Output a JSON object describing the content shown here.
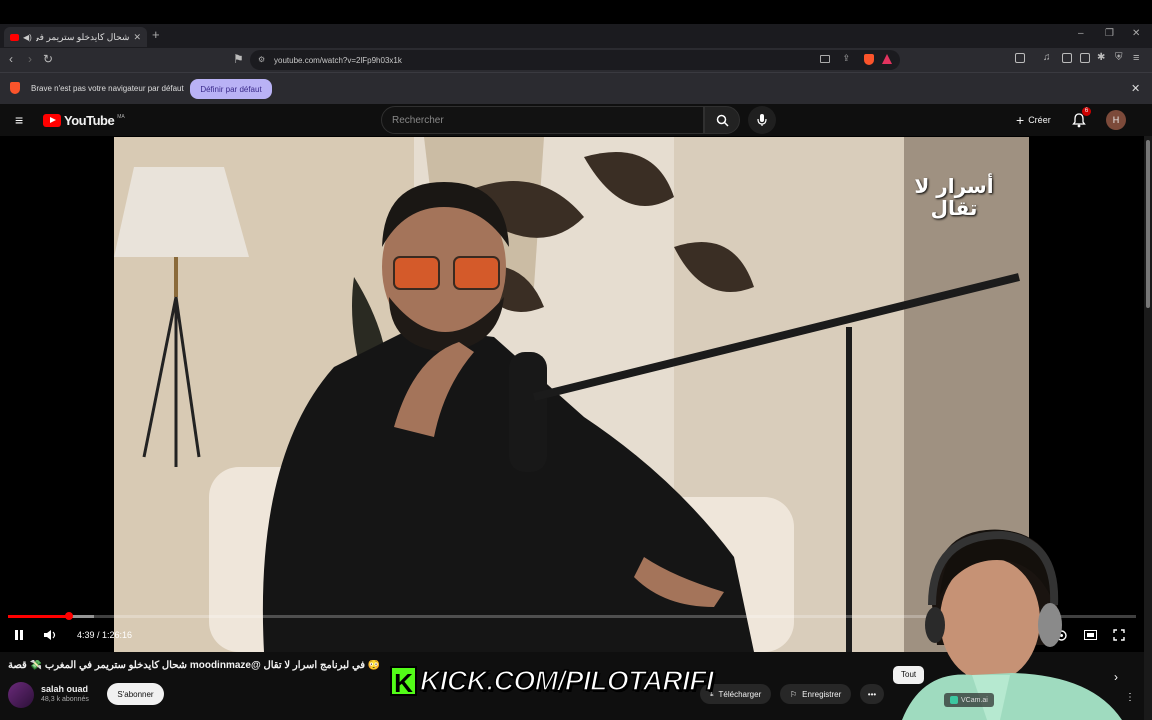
{
  "browser": {
    "tab_title": "شحال كايدخلو ستريمر في",
    "new_tab": "+",
    "url": "youtube.com/watch?v=2lFp9h03x1k",
    "infobar_text": "Brave n'est pas votre navigateur par défaut",
    "infobar_button": "Définir par défaut",
    "win_min": "–",
    "win_max": "❐",
    "win_close": "✕"
  },
  "youtube": {
    "logo_text": "YouTube",
    "country_code": "MA",
    "search_placeholder": "Rechercher",
    "create_label": "Créer",
    "notif_count": "6",
    "avatar_letter": "H"
  },
  "player": {
    "time": "4:39 / 1:26:16",
    "progress_fraction": 0.054,
    "buffered_fraction": 0.076,
    "overlay_logo_text": "أسرار لا تقال"
  },
  "video_info": {
    "title": "😳 في لبرنامج أسرار لا تقال @moodinmaze شحال كايدخلو ستريمر في المغرب 💸 قصة",
    "channel_name": "salah ouad",
    "channel_subs": "48,3 k abonnés",
    "subscribe_label": "S'abonner",
    "download_label": "Télécharger",
    "save_label": "Enregistrer",
    "more_label": "•••",
    "tooltip_partial": "Tout",
    "vcam_label": "VCam.ai"
  },
  "stream_overlay": {
    "k_letter": "K",
    "kick_text": "KICK.COM/PILOTARIFI"
  },
  "colors": {
    "yt_red": "#ff0000",
    "kick_green": "#53fc18",
    "infobar_button_bg": "#b9b2f5"
  }
}
